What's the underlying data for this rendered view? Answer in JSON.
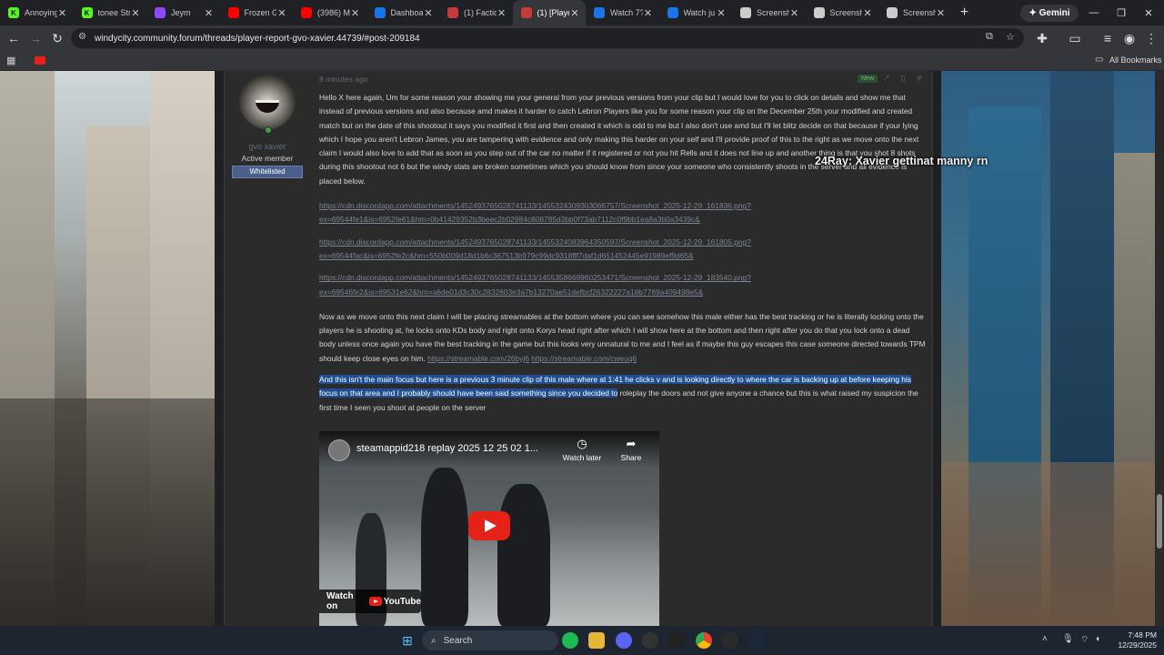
{
  "browser": {
    "tabs": [
      {
        "title": "Annoying",
        "favicon_color": "#53fc18",
        "favicon_letter": "K"
      },
      {
        "title": "tonee Str",
        "favicon_color": "#53fc18",
        "favicon_letter": "K"
      },
      {
        "title": "Jeym",
        "favicon_color": "#9146ff",
        "favicon_letter": ""
      },
      {
        "title": "Frozen G",
        "favicon_color": "#ff0000",
        "favicon_letter": ""
      },
      {
        "title": "(3986) M",
        "favicon_color": "#ff0000",
        "favicon_letter": ""
      },
      {
        "title": "Dashboa",
        "favicon_color": "#1a73e8",
        "favicon_letter": ""
      },
      {
        "title": "(1) Factio",
        "favicon_color": "#c43b3b",
        "favicon_letter": ""
      },
      {
        "title": "(1) [Playe",
        "favicon_color": "#c43b3b",
        "favicon_letter": ""
      },
      {
        "title": "Watch 7?",
        "favicon_color": "#1a73e8",
        "favicon_letter": ""
      },
      {
        "title": "Watch ju",
        "favicon_color": "#1a73e8",
        "favicon_letter": ""
      },
      {
        "title": "Screensh",
        "favicon_color": "#cccccc",
        "favicon_letter": ""
      },
      {
        "title": "Screensh",
        "favicon_color": "#cccccc",
        "favicon_letter": ""
      },
      {
        "title": "Screensh",
        "favicon_color": "#cccccc",
        "favicon_letter": ""
      }
    ],
    "active_tab_index": 7,
    "new_tab": "+",
    "gemini_label": "Gemini",
    "url": "windycity.community.forum/threads/player-report-gvo-xavier.44739/#post-209184",
    "all_bookmarks": "All Bookmarks"
  },
  "post": {
    "time": "8 minutes ago",
    "new_badge": "New",
    "author": {
      "name": "gvo xavier",
      "title": "Active member",
      "banner": "Whitelisted"
    },
    "paragraph1": "Hello X here again, Um for some reason your showing me your general from your previous versions from your clip but I would love for you to click on details and show me that instead of previous versions and also because amd makes it harder to catch Lebron Players like you for some reason your clip on the December 25th your modified and created match but on the date of this shootout it says you modified it first and then created it which is odd to me but I also don't use amd but I'll let blitz decide on that because if your lying which I hope you aren't Lebron James, you are tampering with evidence and only making this harder on your self and I'll provide proof of this to the right as we move onto the next claim I would also love to add that as soon as you step out of the car no matter if it registered or not you hit Rells and it does not line up and another thing is that you shot 8 shots during this shootout not 6 but the windy stats are broken sometimes which you should know from since your someone who consistently shoots in the server and all evidence is placed below.",
    "links": [
      "https://cdn.discordapp.com/attachments/1452493765028741133/1455324309303066757/Screenshot_2025-12-29_161836.png?ex=69544fe1&is=6952fe61&hm=0b41429352b3beec2b02984c808785d3bb0f73ab7112c0f9bb1ea8a3b0a3439c&",
      "https://cdn.discordapp.com/attachments/1452493765028741133/1455324083964350597/Screenshot_2025-12-29_161805.png?ex=69544fac&is=6952fe2c&hm=550b009d18d1b6c367513b979c99dc9318fff7daf1d651452445e91989ef9d65&",
      "https://cdn.discordapp.com/attachments/1452493765028741133/1455358669960253471/Screenshot_2025-12-29_183540.png?ex=69546fe2&is=69531e62&hm=a6de01d3c30c2832603e3a7b13270ae51defbcf26322227a18b7769a409498e5&"
    ],
    "paragraph2": "Now as we move onto this next claim I will be placing streamables at the bottom where you can see somehow this male either has the best tracking or he is literally locking onto the players he is shooting at, he locks onto KDs body and right onto Korys head right after which I will show here at the bottom and then right after you do that you lock onto a dead body unless once again you have the best tracking in the game but this looks very unnatural to me and I feel as if maybe this guy escapes this case someone directed towards TPM should keep close eyes on him.",
    "streamable1": "https://streamable.com/26byj6",
    "streamable2": "https://streamable.com/cweuq6",
    "paragraph3_highlighted": "And this isn't the main focus but here is a previous 3 minute clip of this male where at 1:41 he clicks v and is looking directly to where the car is backing up at before keeping his focus on that area and I probably should have been said something since you decided to",
    "paragraph3_rest": " roleplay the doors and not give anyone a chance but this is what raised my suspicion the first time I seen you shoot at people on the server"
  },
  "video": {
    "title": "steamappid218 replay 2025 12 25 02 1...",
    "watch_later": "Watch later",
    "share": "Share",
    "watch_on": "Watch on",
    "youtube": "YouTube"
  },
  "stream_overlay": "24Ray:  Xavier gettinat manny rn",
  "taskbar": {
    "search_placeholder": "Search",
    "time": "7:48 PM",
    "date": "12/29/2025"
  }
}
